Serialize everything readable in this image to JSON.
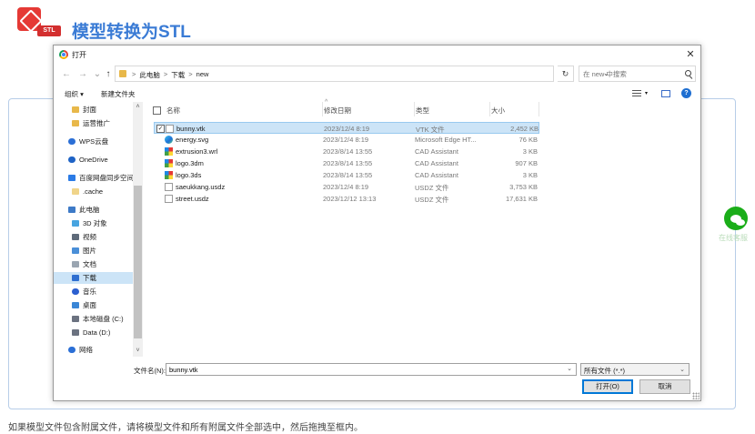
{
  "page": {
    "title": "模型转换为STL",
    "logo_tag": "STL",
    "hint": "如果模型文件包含附属文件，请将模型文件和所有附属文件全部选中，然后拖拽至框内。",
    "wechat_label": "在线客服"
  },
  "dialog": {
    "title": "打开",
    "address": {
      "crumbs": [
        "此电脑",
        "下载",
        "new"
      ],
      "separator": ">"
    },
    "search": {
      "placeholder": "在 new 中搜索"
    },
    "toolbar": {
      "organize": "组织 ▾",
      "new_folder": "新建文件夹"
    },
    "nav_items": [
      {
        "label": "封面",
        "icon": "folder-icon"
      },
      {
        "label": "运营推广",
        "icon": "folder-icon"
      },
      {
        "label": "WPS云盘",
        "icon": "cloud-icon"
      },
      {
        "label": "OneDrive",
        "icon": "onedrive-icon"
      },
      {
        "label": "百度网盘同步空间",
        "icon": "baidu-icon"
      },
      {
        "label": ".cache",
        "icon": "folder-icon"
      },
      {
        "label": "此电脑",
        "icon": "pc-icon"
      },
      {
        "label": "3D 对象",
        "icon": "3d-objects-icon"
      },
      {
        "label": "视频",
        "icon": "video-icon"
      },
      {
        "label": "图片",
        "icon": "pictures-icon"
      },
      {
        "label": "文档",
        "icon": "documents-icon"
      },
      {
        "label": "下载",
        "icon": "downloads-icon",
        "selected": true
      },
      {
        "label": "音乐",
        "icon": "music-icon"
      },
      {
        "label": "桌面",
        "icon": "desktop-icon"
      },
      {
        "label": "本地磁盘 (C:)",
        "icon": "disk-icon"
      },
      {
        "label": "Data (D:)",
        "icon": "disk-icon"
      },
      {
        "label": "网络",
        "icon": "network-icon"
      }
    ],
    "columns": {
      "name": "名称",
      "date": "修改日期",
      "type": "类型",
      "size": "大小"
    },
    "files": [
      {
        "name": "bunny.vtk",
        "date": "2023/12/4 8:19",
        "type": "VTK 文件",
        "size": "2,452 KB",
        "icon": "file-icon",
        "selected": true
      },
      {
        "name": "energy.svg",
        "date": "2023/12/4 8:19",
        "type": "Microsoft Edge HT...",
        "size": "76 KB",
        "icon": "edge-icon"
      },
      {
        "name": "extrusion3.wrl",
        "date": "2023/8/14 13:55",
        "type": "CAD Assistant",
        "size": "3 KB",
        "icon": "cad-icon"
      },
      {
        "name": "logo.3dm",
        "date": "2023/8/14 13:55",
        "type": "CAD Assistant",
        "size": "907 KB",
        "icon": "cad-icon"
      },
      {
        "name": "logo.3ds",
        "date": "2023/8/14 13:55",
        "type": "CAD Assistant",
        "size": "3 KB",
        "icon": "cad-icon"
      },
      {
        "name": "saeukkang.usdz",
        "date": "2023/12/4 8:19",
        "type": "USDZ 文件",
        "size": "3,753 KB",
        "icon": "file-icon"
      },
      {
        "name": "street.usdz",
        "date": "2023/12/12 13:13",
        "type": "USDZ 文件",
        "size": "17,631 KB",
        "icon": "file-icon"
      }
    ],
    "filename_label": "文件名(N):",
    "filename_value": "bunny.vtk",
    "filter_value": "所有文件 (*.*)",
    "open_label": "打开(O)",
    "cancel_label": "取消"
  },
  "colors": {
    "accent": "#3a7bd5",
    "selection": "#cce4f7",
    "brand_red": "#e53935",
    "wechat_green": "#1aad19"
  }
}
